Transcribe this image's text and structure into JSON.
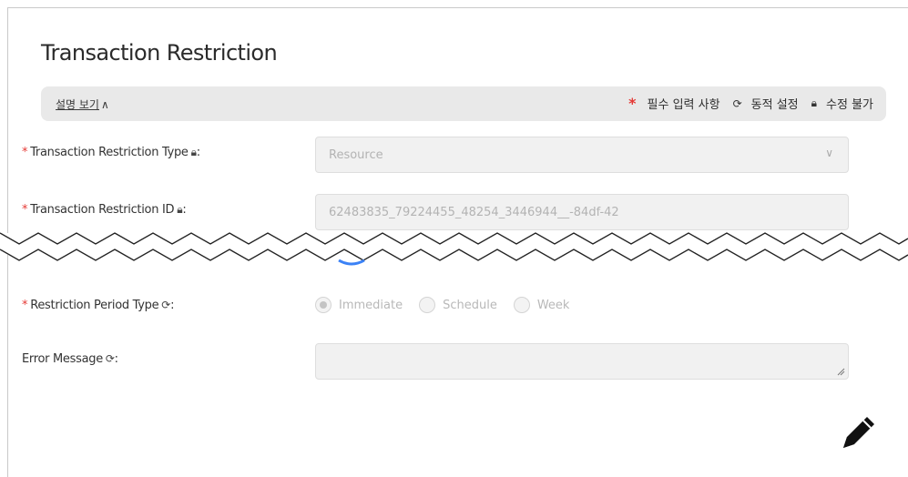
{
  "form": {
    "title": "Transaction Restriction",
    "description_toggle": "설명 보기",
    "legend": {
      "required_mark": "*",
      "required_text": "필수 입력 사항",
      "dynamic_text": "동적 설정",
      "readonly_text": "수정 불가"
    },
    "fields": {
      "restriction_type": {
        "required_mark": "*",
        "label": "Transaction Restriction Type",
        "suffix": ":",
        "value": "Resource"
      },
      "restriction_id": {
        "required_mark": "*",
        "label": "Transaction Restriction ID",
        "suffix": ":",
        "value": "62483835_79224455_48254_3446944__-84df-42"
      },
      "period_type": {
        "required_mark": "*",
        "label": "Restriction Period Type",
        "suffix": ":",
        "options": [
          "Immediate",
          "Schedule",
          "Week"
        ],
        "selected": "Immediate"
      },
      "error_message": {
        "label": "Error Message",
        "suffix": ":",
        "value": ""
      }
    }
  },
  "icons": {
    "lock": "lock-icon",
    "refresh": "refresh-icon",
    "chevron": "chevron-down-icon",
    "caret": "caret-up-icon",
    "edit": "pencil-icon"
  },
  "colors": {
    "required": "#e53935",
    "toggle_blue": "#3b82f6"
  }
}
